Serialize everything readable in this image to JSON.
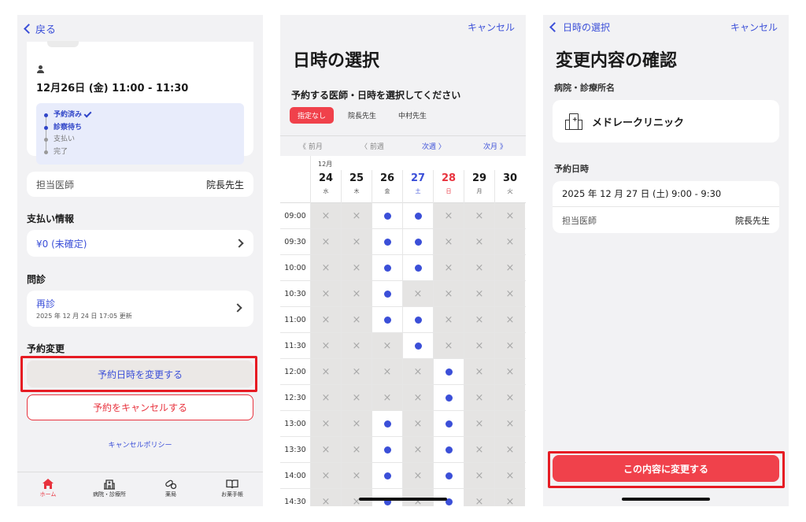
{
  "screen1": {
    "back_label": "戻る",
    "appointment_date": "12月26日 (金) 11:00 - 11:30",
    "status_steps": [
      {
        "label": "予約済み",
        "done": true
      },
      {
        "label": "診察待ち",
        "done": true
      },
      {
        "label": "支払い",
        "done": false
      },
      {
        "label": "完了",
        "done": false
      }
    ],
    "doctor_label": "担当医師",
    "doctor_value": "院長先生",
    "payment_title": "支払い情報",
    "payment_value": "¥0 (未確定)",
    "monshin_title": "問診",
    "monshin_value": "再診",
    "monshin_updated": "2025 年 12 月 24 日 17:05 更新",
    "change_title": "予約変更",
    "change_button": "予約日時を変更する",
    "cancel_button": "予約をキャンセルする",
    "cancel_policy": "キャンセルポリシー",
    "tabs": [
      {
        "label": "ホーム",
        "icon": "home-icon",
        "active": true
      },
      {
        "label": "病院・診療所",
        "icon": "hospital-icon",
        "active": false
      },
      {
        "label": "薬局",
        "icon": "pill-icon",
        "active": false
      },
      {
        "label": "お薬手帳",
        "icon": "book-icon",
        "active": false
      }
    ]
  },
  "screen2": {
    "cancel_label": "キャンセル",
    "title": "日時の選択",
    "prompt": "予約する医師・日時を選択してください",
    "doctor_tabs": [
      {
        "label": "指定なし",
        "selected": true
      },
      {
        "label": "院長先生",
        "selected": false
      },
      {
        "label": "中村先生",
        "selected": false
      }
    ],
    "nav": {
      "prev_month": "前月",
      "prev_week": "前週",
      "next_week": "次週",
      "next_month": "次月"
    },
    "month_label": "12月",
    "days": [
      {
        "num": "24",
        "wd": "水",
        "type": ""
      },
      {
        "num": "25",
        "wd": "木",
        "type": ""
      },
      {
        "num": "26",
        "wd": "金",
        "type": ""
      },
      {
        "num": "27",
        "wd": "土",
        "type": "sat"
      },
      {
        "num": "28",
        "wd": "日",
        "type": "sun"
      },
      {
        "num": "29",
        "wd": "月",
        "type": ""
      },
      {
        "num": "30",
        "wd": "火",
        "type": ""
      }
    ],
    "slots": [
      {
        "time": "09:00",
        "avail": [
          0,
          0,
          1,
          1,
          0,
          0,
          0
        ]
      },
      {
        "time": "09:30",
        "avail": [
          0,
          0,
          1,
          1,
          0,
          0,
          0
        ]
      },
      {
        "time": "10:00",
        "avail": [
          0,
          0,
          1,
          1,
          0,
          0,
          0
        ]
      },
      {
        "time": "10:30",
        "avail": [
          0,
          0,
          1,
          0,
          0,
          0,
          0
        ]
      },
      {
        "time": "11:00",
        "avail": [
          0,
          0,
          1,
          1,
          0,
          0,
          0
        ]
      },
      {
        "time": "11:30",
        "avail": [
          0,
          0,
          0,
          1,
          0,
          0,
          0
        ]
      },
      {
        "time": "12:00",
        "avail": [
          0,
          0,
          0,
          0,
          1,
          0,
          0
        ]
      },
      {
        "time": "12:30",
        "avail": [
          0,
          0,
          0,
          0,
          1,
          0,
          0
        ]
      },
      {
        "time": "13:00",
        "avail": [
          0,
          0,
          1,
          0,
          1,
          0,
          0
        ]
      },
      {
        "time": "13:30",
        "avail": [
          0,
          0,
          1,
          0,
          1,
          0,
          0
        ]
      },
      {
        "time": "14:00",
        "avail": [
          0,
          0,
          1,
          0,
          1,
          0,
          0
        ]
      },
      {
        "time": "14:30",
        "avail": [
          0,
          0,
          1,
          0,
          1,
          0,
          0
        ]
      }
    ]
  },
  "screen3": {
    "back_label": "日時の選択",
    "cancel_label": "キャンセル",
    "title": "変更内容の確認",
    "clinic_label": "病院・診療所名",
    "clinic_name": "メドレークリニック",
    "datetime_label": "予約日時",
    "datetime_value": "2025 年 12 月 27 日 (土) 9:00 - 9:30",
    "doctor_label": "担当医師",
    "doctor_value": "院長先生",
    "confirm_button": "この内容に変更する"
  },
  "colors": {
    "accent_blue": "#3b4fd8",
    "accent_red": "#f0414b",
    "highlight_red": "#e61b23"
  }
}
